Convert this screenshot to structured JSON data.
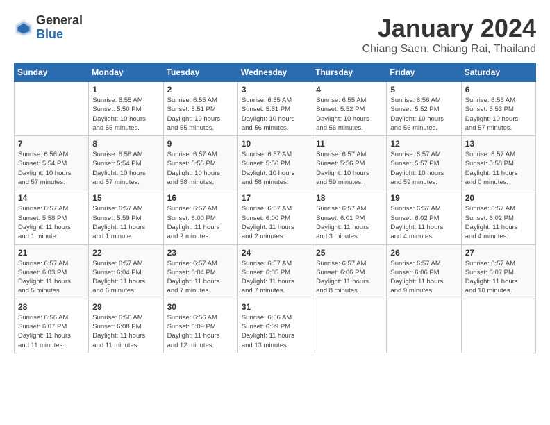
{
  "header": {
    "logo": {
      "general": "General",
      "blue": "Blue"
    },
    "title": "January 2024",
    "location": "Chiang Saen, Chiang Rai, Thailand"
  },
  "weekdays": [
    "Sunday",
    "Monday",
    "Tuesday",
    "Wednesday",
    "Thursday",
    "Friday",
    "Saturday"
  ],
  "weeks": [
    [
      {
        "day": "",
        "info": ""
      },
      {
        "day": "1",
        "info": "Sunrise: 6:55 AM\nSunset: 5:50 PM\nDaylight: 10 hours\nand 55 minutes."
      },
      {
        "day": "2",
        "info": "Sunrise: 6:55 AM\nSunset: 5:51 PM\nDaylight: 10 hours\nand 55 minutes."
      },
      {
        "day": "3",
        "info": "Sunrise: 6:55 AM\nSunset: 5:51 PM\nDaylight: 10 hours\nand 56 minutes."
      },
      {
        "day": "4",
        "info": "Sunrise: 6:55 AM\nSunset: 5:52 PM\nDaylight: 10 hours\nand 56 minutes."
      },
      {
        "day": "5",
        "info": "Sunrise: 6:56 AM\nSunset: 5:52 PM\nDaylight: 10 hours\nand 56 minutes."
      },
      {
        "day": "6",
        "info": "Sunrise: 6:56 AM\nSunset: 5:53 PM\nDaylight: 10 hours\nand 57 minutes."
      }
    ],
    [
      {
        "day": "7",
        "info": "Sunrise: 6:56 AM\nSunset: 5:54 PM\nDaylight: 10 hours\nand 57 minutes."
      },
      {
        "day": "8",
        "info": "Sunrise: 6:56 AM\nSunset: 5:54 PM\nDaylight: 10 hours\nand 57 minutes."
      },
      {
        "day": "9",
        "info": "Sunrise: 6:57 AM\nSunset: 5:55 PM\nDaylight: 10 hours\nand 58 minutes."
      },
      {
        "day": "10",
        "info": "Sunrise: 6:57 AM\nSunset: 5:56 PM\nDaylight: 10 hours\nand 58 minutes."
      },
      {
        "day": "11",
        "info": "Sunrise: 6:57 AM\nSunset: 5:56 PM\nDaylight: 10 hours\nand 59 minutes."
      },
      {
        "day": "12",
        "info": "Sunrise: 6:57 AM\nSunset: 5:57 PM\nDaylight: 10 hours\nand 59 minutes."
      },
      {
        "day": "13",
        "info": "Sunrise: 6:57 AM\nSunset: 5:58 PM\nDaylight: 11 hours\nand 0 minutes."
      }
    ],
    [
      {
        "day": "14",
        "info": "Sunrise: 6:57 AM\nSunset: 5:58 PM\nDaylight: 11 hours\nand 1 minute."
      },
      {
        "day": "15",
        "info": "Sunrise: 6:57 AM\nSunset: 5:59 PM\nDaylight: 11 hours\nand 1 minute."
      },
      {
        "day": "16",
        "info": "Sunrise: 6:57 AM\nSunset: 6:00 PM\nDaylight: 11 hours\nand 2 minutes."
      },
      {
        "day": "17",
        "info": "Sunrise: 6:57 AM\nSunset: 6:00 PM\nDaylight: 11 hours\nand 2 minutes."
      },
      {
        "day": "18",
        "info": "Sunrise: 6:57 AM\nSunset: 6:01 PM\nDaylight: 11 hours\nand 3 minutes."
      },
      {
        "day": "19",
        "info": "Sunrise: 6:57 AM\nSunset: 6:02 PM\nDaylight: 11 hours\nand 4 minutes."
      },
      {
        "day": "20",
        "info": "Sunrise: 6:57 AM\nSunset: 6:02 PM\nDaylight: 11 hours\nand 4 minutes."
      }
    ],
    [
      {
        "day": "21",
        "info": "Sunrise: 6:57 AM\nSunset: 6:03 PM\nDaylight: 11 hours\nand 5 minutes."
      },
      {
        "day": "22",
        "info": "Sunrise: 6:57 AM\nSunset: 6:04 PM\nDaylight: 11 hours\nand 6 minutes."
      },
      {
        "day": "23",
        "info": "Sunrise: 6:57 AM\nSunset: 6:04 PM\nDaylight: 11 hours\nand 7 minutes."
      },
      {
        "day": "24",
        "info": "Sunrise: 6:57 AM\nSunset: 6:05 PM\nDaylight: 11 hours\nand 7 minutes."
      },
      {
        "day": "25",
        "info": "Sunrise: 6:57 AM\nSunset: 6:06 PM\nDaylight: 11 hours\nand 8 minutes."
      },
      {
        "day": "26",
        "info": "Sunrise: 6:57 AM\nSunset: 6:06 PM\nDaylight: 11 hours\nand 9 minutes."
      },
      {
        "day": "27",
        "info": "Sunrise: 6:57 AM\nSunset: 6:07 PM\nDaylight: 11 hours\nand 10 minutes."
      }
    ],
    [
      {
        "day": "28",
        "info": "Sunrise: 6:56 AM\nSunset: 6:07 PM\nDaylight: 11 hours\nand 11 minutes."
      },
      {
        "day": "29",
        "info": "Sunrise: 6:56 AM\nSunset: 6:08 PM\nDaylight: 11 hours\nand 11 minutes."
      },
      {
        "day": "30",
        "info": "Sunrise: 6:56 AM\nSunset: 6:09 PM\nDaylight: 11 hours\nand 12 minutes."
      },
      {
        "day": "31",
        "info": "Sunrise: 6:56 AM\nSunset: 6:09 PM\nDaylight: 11 hours\nand 13 minutes."
      },
      {
        "day": "",
        "info": ""
      },
      {
        "day": "",
        "info": ""
      },
      {
        "day": "",
        "info": ""
      }
    ]
  ]
}
